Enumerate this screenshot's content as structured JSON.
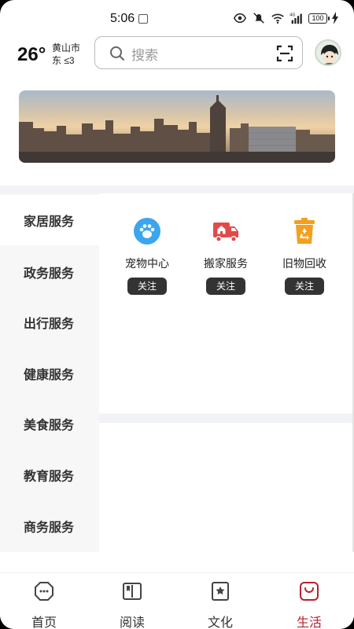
{
  "status_bar": {
    "time": "5:06",
    "network": "4G",
    "battery": "100"
  },
  "header": {
    "temperature": "26°",
    "city": "黄山市",
    "wind": "东 ≤3",
    "search": {
      "placeholder": "搜索"
    }
  },
  "sidebar": {
    "items": [
      {
        "label": "家居服务",
        "active": true
      },
      {
        "label": "政务服务"
      },
      {
        "label": "出行服务"
      },
      {
        "label": "健康服务"
      },
      {
        "label": "美食服务"
      },
      {
        "label": "教育服务"
      },
      {
        "label": "商务服务"
      }
    ]
  },
  "services": [
    {
      "label": "宠物中心",
      "follow": "关注",
      "icon": "paw-icon",
      "color": "#3ba6ef"
    },
    {
      "label": "搬家服务",
      "follow": "关注",
      "icon": "truck-icon",
      "color": "#e24a4a"
    },
    {
      "label": "旧物回收",
      "follow": "关注",
      "icon": "recycle-bin-icon",
      "color": "#f2a01e"
    }
  ],
  "tabbar": {
    "items": [
      {
        "label": "首页",
        "icon": "home-icon"
      },
      {
        "label": "阅读",
        "icon": "book-icon"
      },
      {
        "label": "文化",
        "icon": "culture-icon"
      },
      {
        "label": "生活",
        "icon": "life-icon",
        "active": true
      }
    ],
    "active_color": "#b8202e"
  }
}
